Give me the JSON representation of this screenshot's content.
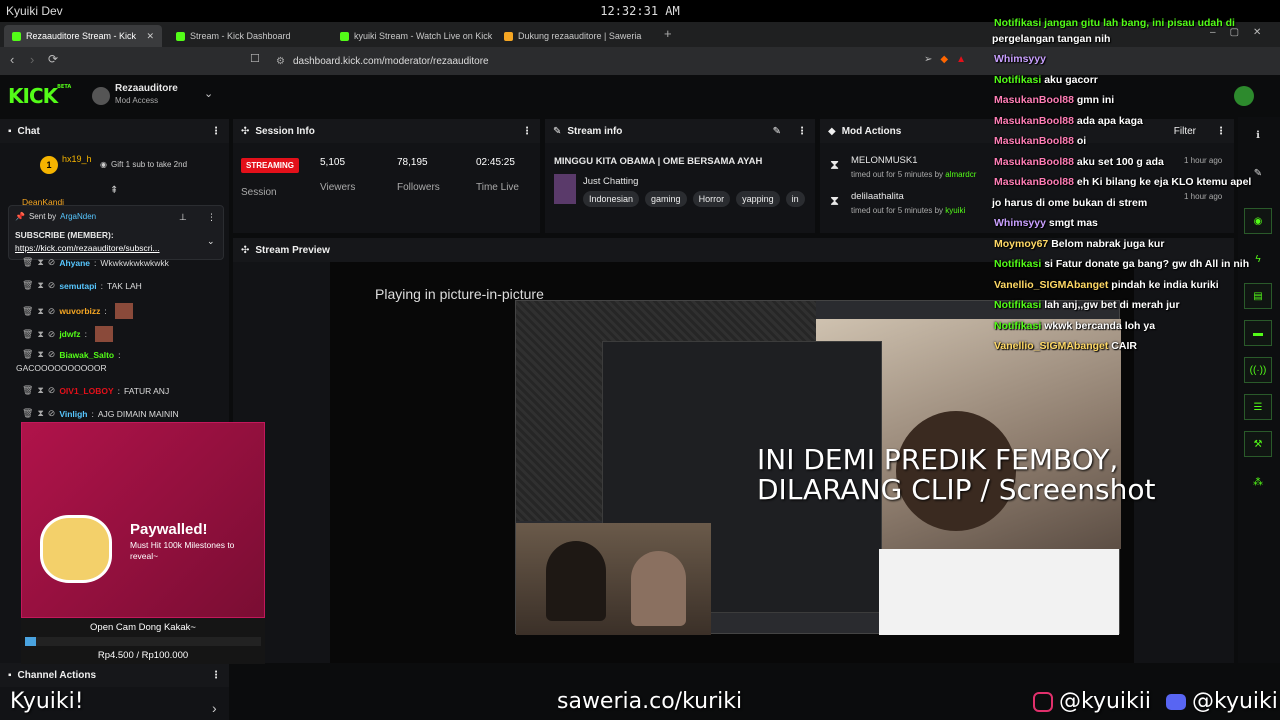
{
  "system_bar": {
    "app_title": "Kyuiki Dev",
    "clock": "12:32:31 AM"
  },
  "browser": {
    "tabs": [
      {
        "label": "Rezaauditore Stream - Kick",
        "favicon_color": "#53fc18",
        "active": true
      },
      {
        "label": "Stream - Kick Dashboard",
        "favicon_color": "#53fc18",
        "active": false
      },
      {
        "label": "kyuiki Stream - Watch Live on Kick",
        "favicon_color": "#53fc18",
        "active": false
      },
      {
        "label": "Dukung rezaauditore | Saweria",
        "favicon_color": "#f5a623",
        "active": false
      }
    ],
    "url": "dashboard.kick.com/moderator/rezaauditore"
  },
  "kick_header": {
    "logo": "KICK",
    "logo_beta": "BETA",
    "channel_name": "Rezaauditore",
    "role": "Mod Access"
  },
  "chat": {
    "title": "Chat",
    "sub_gift": {
      "user": "hx19_h",
      "level": "1",
      "text": "Gift 1 sub to take 2nd"
    },
    "pinned": {
      "sent_by_label": "Sent by",
      "sent_by_user": "ArgaNden",
      "title": "SUBSCRIBE (MEMBER):",
      "link": "https://kick.com/rezaauditore/subscri..."
    },
    "partial_user": "DeanKandi",
    "messages": [
      {
        "user": "Ahyane",
        "color": "#57c7ff",
        "text": "Wkwkwkwkwkwkk"
      },
      {
        "user": "semutapi",
        "color": "#57c7ff",
        "text": "TAK LAH"
      },
      {
        "user": "wuvorbizz",
        "color": "#f5a623",
        "text": ""
      },
      {
        "user": "jdwfz",
        "color": "#53fc18",
        "text": ""
      },
      {
        "user": "Biawak_Salto",
        "color": "#53fc18",
        "text": "GACOOOOOOOOOOR"
      },
      {
        "user": "OIV1_LOBOY",
        "color": "#e3101a",
        "text": "FATUR ANJ"
      },
      {
        "user": "Vinligh",
        "color": "#57c7ff",
        "text": "AJG DIMAIN MAININ"
      }
    ]
  },
  "channel_actions": {
    "title": "Channel Actions"
  },
  "session_info": {
    "title": "Session Info",
    "status": "STREAMING",
    "status_label": "Session",
    "viewers_value": "5,105",
    "viewers_label": "Viewers",
    "followers_value": "78,195",
    "followers_label": "Followers",
    "time_value": "02:45:25",
    "time_label": "Time Live"
  },
  "stream_info": {
    "title": "Stream info",
    "stream_title": "MINGGU KITA OBAMA | OME BERSAMA AYAH",
    "category": "Just Chatting",
    "tags": [
      "Indonesian",
      "gaming",
      "Horror",
      "yapping",
      "in"
    ]
  },
  "mod_actions": {
    "title": "Mod Actions",
    "filter": "Filter",
    "items": [
      {
        "user": "MELONMUSK1",
        "detail": "timed out for 5 minutes by",
        "by": "almardcr",
        "time": "1 hour ago"
      },
      {
        "user": "delilaathalita",
        "detail": "timed out for 5 minutes by",
        "by": "kyuiki",
        "time": "1 hour ago"
      }
    ]
  },
  "stream_preview": {
    "title": "Stream Preview",
    "pip_text": "Playing in picture-in-picture"
  },
  "overlay": {
    "top_text_1": "Notifikasi jangan gitu lah bang, ini pisau udah di",
    "top_text_2": "pergelangan tangan nih",
    "chat": [
      {
        "user": "Whimsyyy",
        "color": "#c9a0ff",
        "text": ""
      },
      {
        "user": "Notifikasi",
        "color": "#53fc18",
        "text": "aku gacorr"
      },
      {
        "user": "MasukanBool88",
        "color": "#ff7eb6",
        "text": "gmn ini"
      },
      {
        "user": "MasukanBool88",
        "color": "#ff7eb6",
        "text": "ada apa kaga"
      },
      {
        "user": "MasukanBool88",
        "color": "#ff7eb6",
        "text": "oi"
      },
      {
        "user": "MasukanBool88",
        "color": "#ff7eb6",
        "text": "aku set 100 g ada"
      },
      {
        "user": "MasukanBool88",
        "color": "#ff7eb6",
        "text": "eh Ki bilang ke eja KLO ktemu apel"
      },
      {
        "user": "",
        "color": "#ffffff",
        "text": "jo harus di ome bukan di strem"
      },
      {
        "user": "Whimsyyy",
        "color": "#c9a0ff",
        "text": "smgt mas"
      },
      {
        "user": "Moymoy67",
        "color": "#ffd966",
        "text": "Belom nabrak juga kur"
      },
      {
        "user": "Notifikasi",
        "color": "#53fc18",
        "text": "si Fatur donate ga bang? gw dh All in nih"
      },
      {
        "user": "Vanellio_SIGMAbanget",
        "color": "#ffd966",
        "text": "pindah ke india kuriki"
      },
      {
        "user": "Notifikasi",
        "color": "#53fc18",
        "text": "lah anj,,gw bet di merah jur"
      },
      {
        "user": "Notifikasi",
        "color": "#53fc18",
        "text": "wkwk bercanda loh ya"
      },
      {
        "user": "Vanellio_SIGMAbanget",
        "color": "#ffd966",
        "text": "CAIR"
      }
    ],
    "big_text_1": "INI DEMI PREDIK FEMBOY,",
    "big_text_2": "DILARANG CLIP / Screenshot",
    "paywall": {
      "title": "Paywalled!",
      "subtitle": "Must Hit 100k Milestones to reveal~",
      "goal_name": "Open Cam Dong Kakak~",
      "goal_amount": "Rp4.500 / Rp100.000",
      "goal_progress": 0.045
    },
    "footer_left": "Kyuiki!",
    "footer_center": "saweria.co/kuriki",
    "footer_ig": "@kyuikii",
    "footer_discord": "@kyuiki"
  }
}
